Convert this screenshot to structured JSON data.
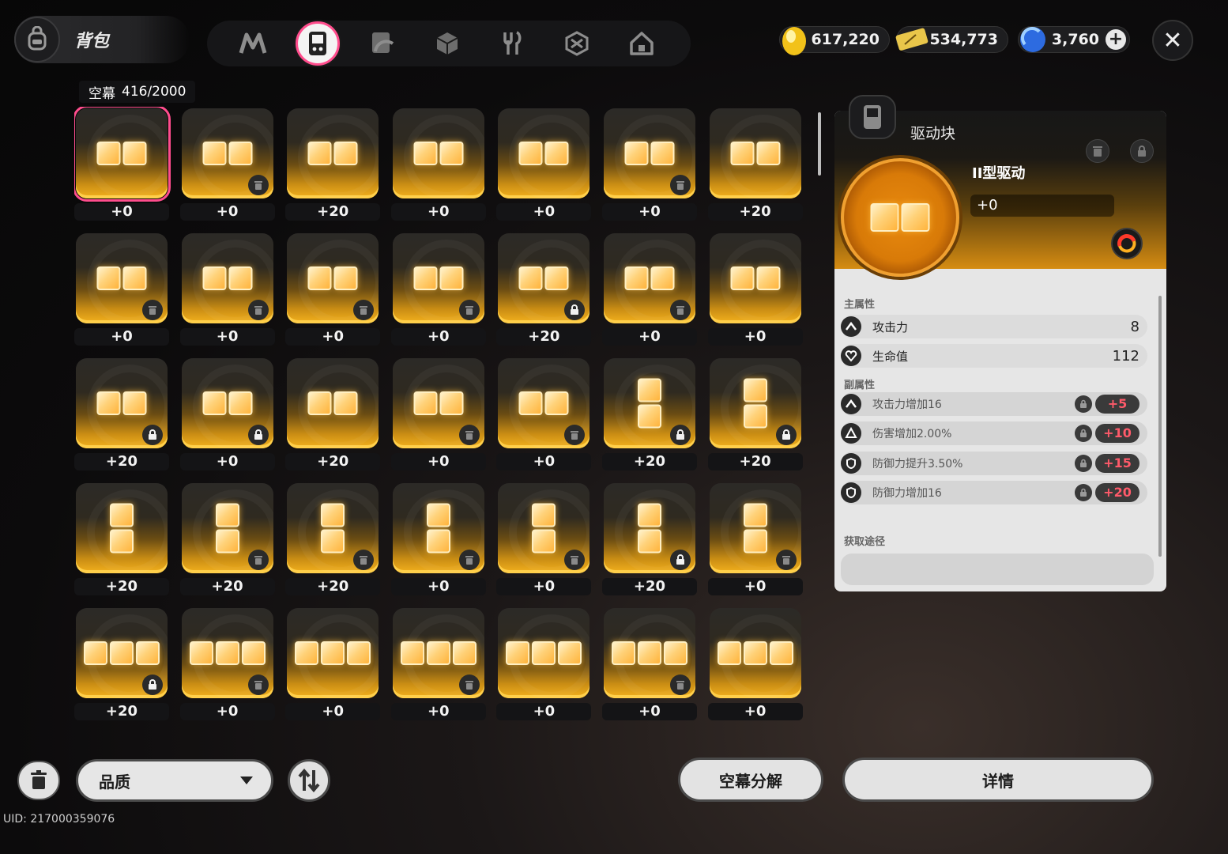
{
  "header": {
    "title": "背包",
    "categories": [
      {
        "name": "neverness-icon",
        "active": false
      },
      {
        "name": "handheld-device-icon",
        "active": true
      },
      {
        "name": "arc-disc-icon",
        "active": false
      },
      {
        "name": "cube-icon",
        "active": false
      },
      {
        "name": "fork-knife-icon",
        "active": false
      },
      {
        "name": "gem-box-icon",
        "active": false
      },
      {
        "name": "house-icon",
        "active": false
      }
    ]
  },
  "currencies": {
    "gold": "617,220",
    "ticket": "534,773",
    "crystal": "3,760"
  },
  "inventory": {
    "label": "空幕",
    "count": "416/2000",
    "items": [
      {
        "shape": "h2",
        "level": "+0",
        "badge": "none"
      },
      {
        "shape": "h2",
        "level": "+0",
        "badge": "trash"
      },
      {
        "shape": "h2",
        "level": "+20",
        "badge": "none"
      },
      {
        "shape": "h2",
        "level": "+0",
        "badge": "none"
      },
      {
        "shape": "h2",
        "level": "+0",
        "badge": "none"
      },
      {
        "shape": "h2",
        "level": "+0",
        "badge": "trash"
      },
      {
        "shape": "h2",
        "level": "+20",
        "badge": "none"
      },
      {
        "shape": "h2",
        "level": "+0",
        "badge": "trash"
      },
      {
        "shape": "h2",
        "level": "+0",
        "badge": "trash"
      },
      {
        "shape": "h2",
        "level": "+0",
        "badge": "trash"
      },
      {
        "shape": "h2",
        "level": "+0",
        "badge": "trash"
      },
      {
        "shape": "h2",
        "level": "+20",
        "badge": "lock"
      },
      {
        "shape": "h2",
        "level": "+0",
        "badge": "trash"
      },
      {
        "shape": "h2",
        "level": "+0",
        "badge": "none"
      },
      {
        "shape": "h2",
        "level": "+20",
        "badge": "lock"
      },
      {
        "shape": "h2",
        "level": "+0",
        "badge": "lock"
      },
      {
        "shape": "h2",
        "level": "+20",
        "badge": "none"
      },
      {
        "shape": "h2",
        "level": "+0",
        "badge": "trash"
      },
      {
        "shape": "h2",
        "level": "+0",
        "badge": "trash"
      },
      {
        "shape": "v2",
        "level": "+20",
        "badge": "lock"
      },
      {
        "shape": "v2",
        "level": "+20",
        "badge": "lock"
      },
      {
        "shape": "v2",
        "level": "+20",
        "badge": "none"
      },
      {
        "shape": "v2",
        "level": "+20",
        "badge": "trash"
      },
      {
        "shape": "v2",
        "level": "+20",
        "badge": "trash"
      },
      {
        "shape": "v2",
        "level": "+0",
        "badge": "trash"
      },
      {
        "shape": "v2",
        "level": "+0",
        "badge": "trash"
      },
      {
        "shape": "v2",
        "level": "+20",
        "badge": "lock"
      },
      {
        "shape": "v2",
        "level": "+0",
        "badge": "trash"
      },
      {
        "shape": "h3",
        "level": "+20",
        "badge": "lock"
      },
      {
        "shape": "h3",
        "level": "+0",
        "badge": "trash"
      },
      {
        "shape": "h3",
        "level": "+0",
        "badge": "none"
      },
      {
        "shape": "h3",
        "level": "+0",
        "badge": "trash"
      },
      {
        "shape": "h3",
        "level": "+0",
        "badge": "none"
      },
      {
        "shape": "h3",
        "level": "+0",
        "badge": "trash"
      },
      {
        "shape": "h3",
        "level": "+0",
        "badge": "none"
      }
    ]
  },
  "detail": {
    "category": "驱动块",
    "name": "II型驱动",
    "level": "+0",
    "main_label": "主属性",
    "main_stats": [
      {
        "name": "攻击力",
        "value": "8",
        "icon": "attack-icon"
      },
      {
        "name": "生命值",
        "value": "112",
        "icon": "heart-icon"
      }
    ],
    "sub_label": "副属性",
    "sub_stats": [
      {
        "name": "攻击力增加16",
        "bonus": "+5",
        "icon": "attack-icon"
      },
      {
        "name": "伤害增加2.00%",
        "bonus": "+10",
        "icon": "damage-icon"
      },
      {
        "name": "防御力提升3.50%",
        "bonus": "+15",
        "icon": "shield-icon"
      },
      {
        "name": "防御力增加16",
        "bonus": "+20",
        "icon": "shield-icon"
      }
    ],
    "source_label": "获取途径"
  },
  "footer": {
    "quality_select": "品质",
    "dismantle_button": "空幕分解",
    "detail_button": "详情",
    "uid": "UID: 217000359076"
  },
  "colors": {
    "accent_pink": "#ff4d8d",
    "tile_gold": "#ffb43d",
    "bonus_red": "#ff5a6a"
  }
}
